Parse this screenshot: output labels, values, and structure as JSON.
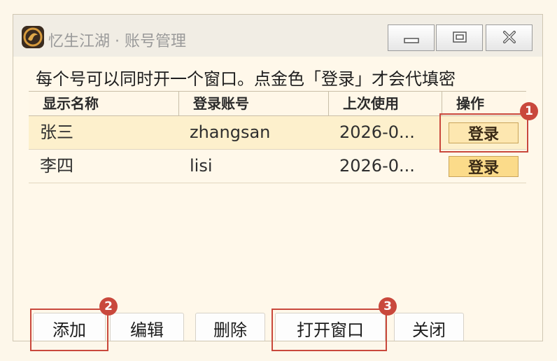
{
  "window": {
    "title": "忆生江湖 · 账号管理"
  },
  "hint_text": "每个号可以同时开一个窗口。点金色「登录」才会代填密",
  "table": {
    "columns": [
      "显示名称",
      "登录账号",
      "上次使用",
      "操作"
    ],
    "rows": [
      {
        "name": "张三",
        "account": "zhangsan",
        "last_used": "2026-0...",
        "action": "登录"
      },
      {
        "name": "李四",
        "account": "lisi",
        "last_used": "2026-0...",
        "action": "登录"
      }
    ]
  },
  "buttons": {
    "add": "添加",
    "edit": "编辑",
    "delete": "删除",
    "open_window": "打开窗口",
    "close": "关闭"
  },
  "callouts": [
    "1",
    "2",
    "3"
  ],
  "colors": {
    "login_gold": "#fbdb8a",
    "selected_row": "#fdf0cc",
    "callout_red": "#c9483c"
  }
}
